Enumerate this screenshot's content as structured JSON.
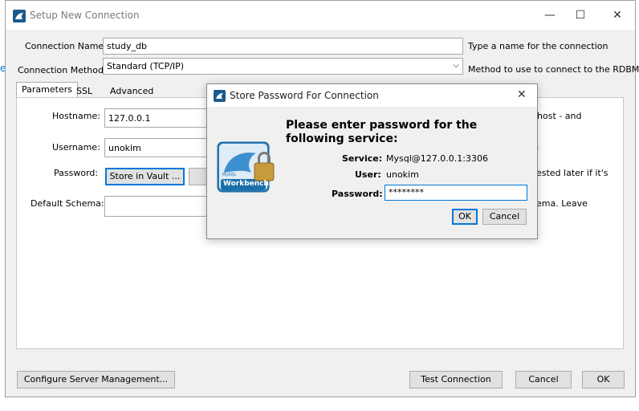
{
  "window": {
    "title": "Setup New Connection",
    "minimize": "—",
    "maximize": "☐",
    "close": "✕"
  },
  "edge_mark": "e",
  "form": {
    "connection_name_label": "Connection Name:",
    "connection_name_value": "study_db",
    "connection_name_hint": "Type a name for the connection",
    "connection_method_label": "Connection Method:",
    "connection_method_value": "Standard (TCP/IP)",
    "connection_method_hint": "Method to use to connect to the RDBMS"
  },
  "tabs": [
    {
      "label": "Parameters"
    },
    {
      "label": "SSL"
    },
    {
      "label": "Advanced"
    }
  ],
  "parameters": {
    "hostname_label": "Hostname:",
    "hostname_value": "127.0.0.1",
    "hostname_hint": "r host - and",
    "username_label": "Username:",
    "username_value": "unokim",
    "username_hint": "h.",
    "password_label": "Password:",
    "store_vault_label": "Store in Vault ...",
    "password_hint": "uested later if it's",
    "default_schema_label": "Default Schema:",
    "default_schema_value": "",
    "default_schema_hint": "hema. Leave"
  },
  "footer": {
    "configure_label": "Configure Server Management...",
    "test_label": "Test Connection",
    "cancel_label": "Cancel",
    "ok_label": "OK"
  },
  "dialog": {
    "title": "Store Password For Connection",
    "close": "✕",
    "heading_line1": "Please enter password for the",
    "heading_line2": "following service:",
    "service_label": "Service:",
    "service_value": "Mysql@127.0.0.1:3306",
    "user_label": "User:",
    "user_value": "unokim",
    "password_label": "Password:",
    "password_value": "********",
    "ok_label": "OK",
    "cancel_label": "Cancel",
    "logo_small": "MySQL",
    "logo_text": "Workbench"
  },
  "colors": {
    "accent": "#0078d7",
    "logo_blue": "#1b6fa8",
    "lock_gold": "#c79a3c"
  }
}
